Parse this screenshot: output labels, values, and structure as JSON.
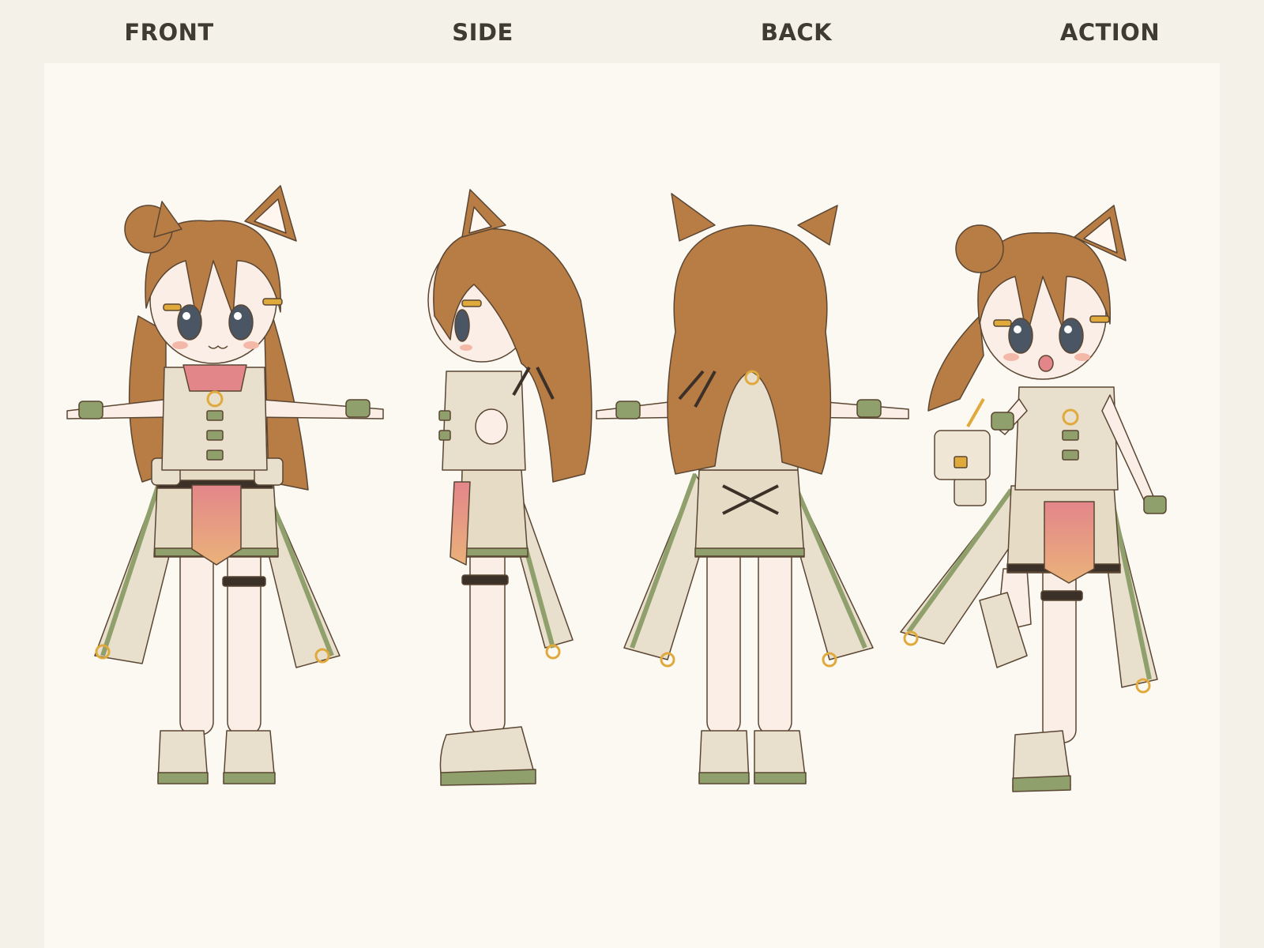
{
  "views": [
    {
      "label": "FRONT"
    },
    {
      "label": "SIDE"
    },
    {
      "label": "BACK"
    },
    {
      "label": "ACTION"
    }
  ],
  "colors": {
    "page_background": "#f4f1e8",
    "panel_background": "#fcf9f3",
    "label_text": "#3f3b33",
    "hair": "#b87c45",
    "hair_shadow": "#8f5b2f",
    "skin": "#fbeee6",
    "outfit_cream": "#e9dfcd",
    "outfit_green": "#8fa06c",
    "accent_pink": "#e3868a",
    "accent_gold": "#e0a93c",
    "eyes": "#4b5665"
  },
  "icons": [
    "character-front-view",
    "character-side-view",
    "character-back-view",
    "character-action-pose"
  ]
}
